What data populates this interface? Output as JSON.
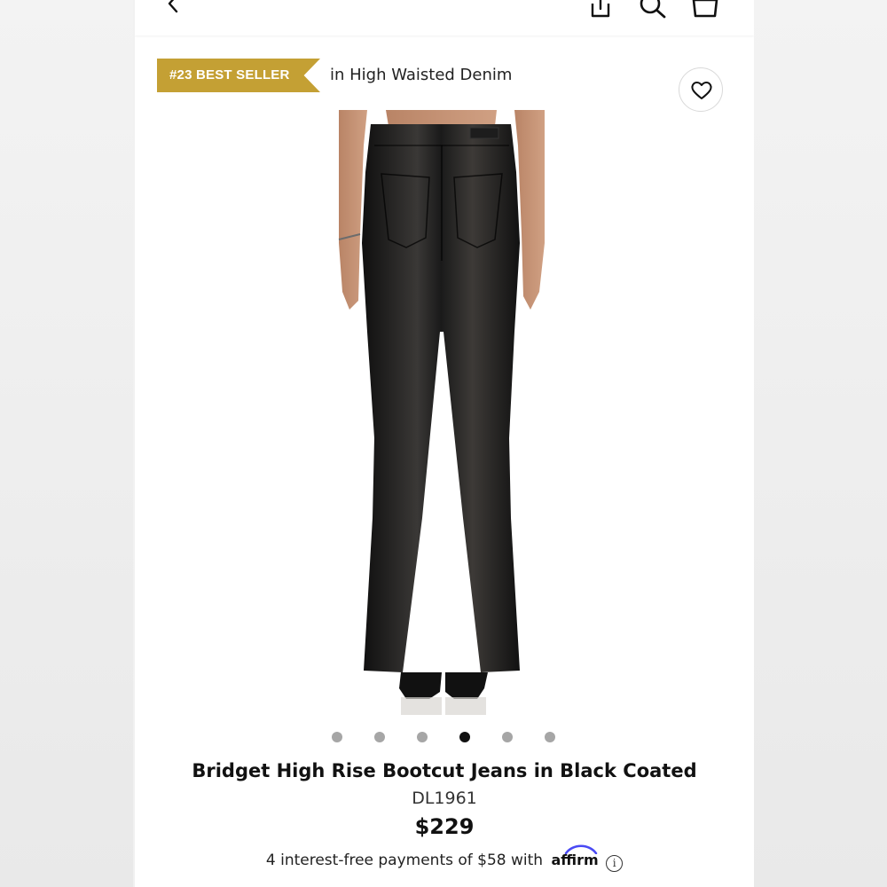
{
  "badge": {
    "label": "#23 BEST SELLER",
    "color": "#c4a034"
  },
  "category": {
    "text": "in High Waisted Denim"
  },
  "carousel": {
    "total": 6,
    "active_index": 3
  },
  "product": {
    "title": "Bridget High Rise Bootcut Jeans in Black Coated",
    "brand": "DL1961",
    "price": "$229"
  },
  "payment": {
    "text": "4 interest-free payments of $58 with",
    "provider": "affirm",
    "info_symbol": "i"
  },
  "icons": {
    "back": "chevron-left-icon",
    "share": "share-icon",
    "search": "search-icon",
    "bag": "shopping-bag-icon",
    "wishlist": "heart-icon",
    "info": "info-icon"
  }
}
